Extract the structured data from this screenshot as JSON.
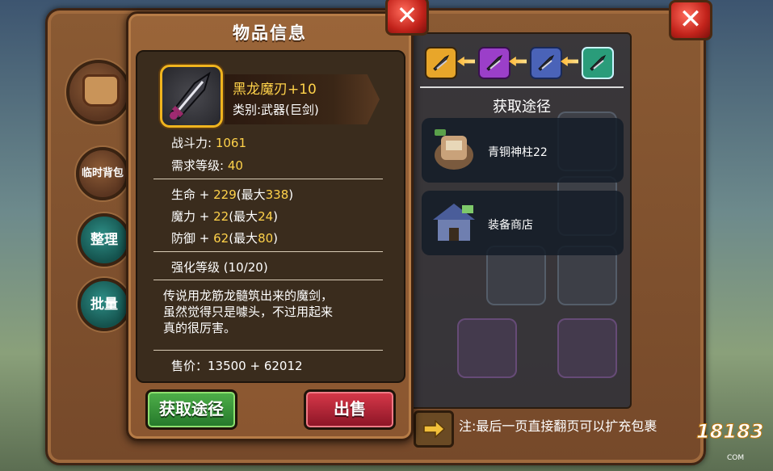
{
  "popup": {
    "title": "物品信息",
    "item": {
      "name": "黑龙魔刃+10",
      "type": "类别:武器(巨剑)"
    },
    "stats": {
      "combat_label": "战斗力: ",
      "combat_value": "1061",
      "level_label": "需求等级: ",
      "level_value": "40",
      "hp_label": "生命 + ",
      "hp_value": "229",
      "hp_max_prefix": "(最大",
      "hp_max": "338",
      "mp_label": "魔力 + ",
      "mp_value": "22",
      "mp_max_prefix": "(最大",
      "mp_max": "24",
      "def_label": "防御 + ",
      "def_value": "62",
      "def_max_prefix": "(最大",
      "def_max": "80",
      "max_suffix": ")",
      "enhance": "强化等级 (10/20)"
    },
    "description": [
      "传说用龙筋龙髓筑出来的魔剑，",
      "虽然觉得只是噱头，不过用起来",
      "真的很厉害。"
    ],
    "price": "售价：13500 + 62012",
    "buttons": {
      "acquire": "获取途径",
      "sell": "出售"
    }
  },
  "side_buttons": {
    "temp_bag": "临时背包",
    "sort": "整理",
    "batch": "批量"
  },
  "acquire_panel": {
    "title": "获取途径",
    "items": [
      {
        "label": "青铜神柱22",
        "icon": "bronze-pillar-icon"
      },
      {
        "label": "装备商店",
        "icon": "equipment-shop-icon"
      }
    ],
    "chain_colors": [
      "#e8a62a",
      "#9b3fc9",
      "#4a63b8",
      "#2a9c7a"
    ]
  },
  "note": "注:最后一页直接翻页可以扩充包裹",
  "watermark": {
    "logo": "18183",
    "sub": "COM"
  },
  "close_symbol": "✕"
}
